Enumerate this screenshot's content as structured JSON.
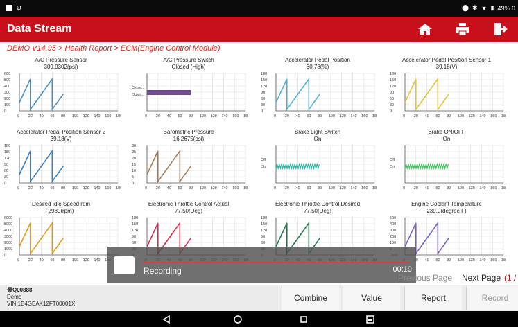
{
  "statusbar": {
    "right_text": "49% 0"
  },
  "titlebar": {
    "title": "Data Stream"
  },
  "breadcrumb": "DEMO V14.95 > Health Report > ECM(Engine Control Module)",
  "colors": {
    "brand_red": "#c8101c",
    "title_bar": "#c8101c"
  },
  "icons": [
    "home-icon",
    "print-icon",
    "exit-icon"
  ],
  "charts": [
    {
      "title": "A/C Pressure Sensor",
      "value": "309.9302(psi)",
      "kind": "saw",
      "color": "#4a8fc0",
      "y_ticks": [
        "600",
        "500",
        "400",
        "300",
        "200",
        "100",
        "0"
      ]
    },
    {
      "title": "A/C Pressure Switch",
      "value": "Closed (High)",
      "kind": "bar",
      "color": "#6f4d8f",
      "y_ticks": [
        "Close...",
        "Open..."
      ]
    },
    {
      "title": "Accelerator Pedal Position",
      "value": "60.78(%)",
      "kind": "saw",
      "color": "#4fb2d8",
      "y_ticks": [
        "180",
        "150",
        "120",
        "90",
        "60",
        "30",
        "0"
      ]
    },
    {
      "title": "Accelerator Pedal Position Sensor 1",
      "value": "39.18(V)",
      "kind": "saw",
      "color": "#e3c43b",
      "y_ticks": [
        "180",
        "150",
        "120",
        "90",
        "60",
        "30",
        "0"
      ]
    },
    {
      "title": "Accelerator Pedal Position Sensor 2",
      "value": "39.18(V)",
      "kind": "saw",
      "color": "#3c7fc2",
      "y_ticks": [
        "180",
        "150",
        "120",
        "90",
        "60",
        "30",
        "0"
      ]
    },
    {
      "title": "Barometric Pressure",
      "value": "16.2675(psi)",
      "kind": "saw",
      "color": "#a67c5a",
      "y_ticks": [
        "30",
        "25",
        "20",
        "15",
        "10",
        "5",
        "0"
      ]
    },
    {
      "title": "Brake Light Switch",
      "value": "On",
      "kind": "wave",
      "color": "#2bb3a0",
      "y_ticks": [
        "Off",
        "On"
      ]
    },
    {
      "title": "Brake ON/OFF",
      "value": "On",
      "kind": "wave",
      "color": "#3cc45a",
      "y_ticks": [
        "Off",
        "On"
      ]
    },
    {
      "title": "Desired Idle Speed rpm",
      "value": "2980(rpm)",
      "kind": "saw",
      "color": "#e39a1c",
      "y_ticks": [
        "6000",
        "5000",
        "4000",
        "3000",
        "2000",
        "1000",
        "0"
      ]
    },
    {
      "title": "Electronic Throttle Control Actual",
      "value": "77.50(Deg)",
      "kind": "saw",
      "color": "#d62a48",
      "y_ticks": [
        "180",
        "150",
        "120",
        "90",
        "60",
        "30",
        "0"
      ]
    },
    {
      "title": "Electronic Throttle Control Desired",
      "value": "77.50(Deg)",
      "kind": "saw",
      "color": "#1f7a4a",
      "y_ticks": [
        "180",
        "150",
        "120",
        "90",
        "60",
        "30",
        "0"
      ]
    },
    {
      "title": "Engine Coolant Temperature",
      "value": "239.0(degree F)",
      "kind": "saw",
      "color": "#7a5fc6",
      "y_ticks": [
        "500",
        "400",
        "300",
        "200",
        "100",
        "0",
        "-100"
      ]
    }
  ],
  "x_ticks": [
    "0",
    "20",
    "40",
    "60",
    "80",
    "100",
    "120",
    "140",
    "160",
    "180"
  ],
  "recording": {
    "label": "Recording",
    "time": "00:19"
  },
  "pager": {
    "prev": "Previous Page",
    "next": "Next Page",
    "current": "(1 /"
  },
  "vehicle": {
    "id": "景Q00888",
    "name": "Demo",
    "vin": "VIN 1E4GEAK12FT00001X"
  },
  "buttons": {
    "combine": "Combine",
    "value": "Value",
    "report": "Report",
    "record": "Record"
  }
}
